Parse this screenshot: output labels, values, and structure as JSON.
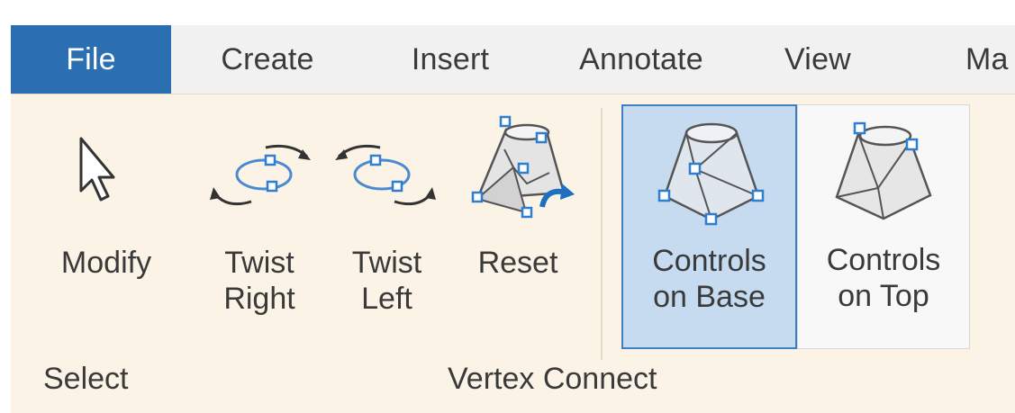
{
  "tabs": [
    {
      "label": "File",
      "active": true
    },
    {
      "label": "Create",
      "active": false
    },
    {
      "label": "Insert",
      "active": false
    },
    {
      "label": "Annotate",
      "active": false
    },
    {
      "label": "View",
      "active": false
    },
    {
      "label": "Ma",
      "active": false
    }
  ],
  "ribbon": {
    "buttons": {
      "modify": {
        "label_line1": "Modify",
        "label_line2": "",
        "icon": "cursor-arrow-icon"
      },
      "twist_right": {
        "label_line1": "Twist",
        "label_line2": "Right",
        "icon": "twist-right-icon"
      },
      "twist_left": {
        "label_line1": "Twist",
        "label_line2": "Left",
        "icon": "twist-left-icon"
      },
      "reset": {
        "label_line1": "Reset",
        "label_line2": "",
        "icon": "reset-frustum-icon"
      },
      "controls_on_base": {
        "label_line1": "Controls",
        "label_line2": "on Base",
        "icon": "frustum-base-controls-icon",
        "pressed": true
      },
      "controls_on_top": {
        "label_line1": "Controls",
        "label_line2": "on Top",
        "icon": "frustum-top-controls-icon",
        "pressed": false
      }
    },
    "groups": {
      "select": "Select",
      "vertex_connect": "Vertex Connect"
    }
  },
  "colors": {
    "file_tab": "#2b6fb2",
    "tabbar_bg": "#f1f1f1",
    "panel_bg": "#fbf3e6",
    "pressed_bg": "#c6dbf0",
    "pressed_border": "#3f7fc2",
    "handle": "#2f7fd0"
  }
}
